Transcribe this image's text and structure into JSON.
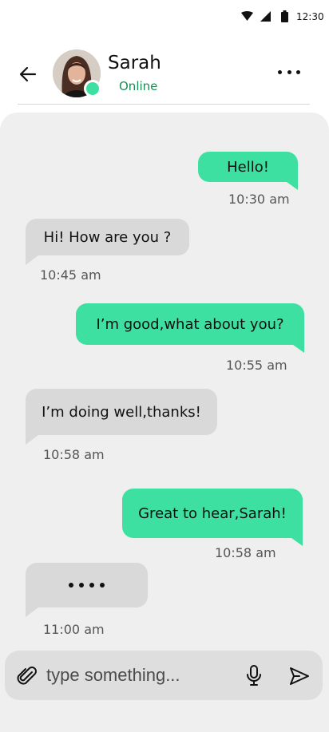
{
  "status_bar": {
    "time": "12:30"
  },
  "header": {
    "name": "Sarah",
    "presence": "Online"
  },
  "messages": [
    {
      "side": "sent",
      "text": "Hello!",
      "time": "10:30 am"
    },
    {
      "side": "recv",
      "text": "Hi! How are you ?",
      "time": "10:45 am"
    },
    {
      "side": "sent",
      "text": "I’m good,what about you?",
      "time": "10:55 am"
    },
    {
      "side": "recv",
      "text": "I’m doing well,thanks!",
      "time": "10:58 am"
    },
    {
      "side": "sent",
      "text": "Great to hear,Sarah!",
      "time": "10:58 am"
    },
    {
      "side": "recv",
      "text": "",
      "time": "11:00 am",
      "typing": true
    }
  ],
  "composer": {
    "placeholder": "type something..."
  },
  "colors": {
    "accent": "#3ee0a1",
    "received_bubble": "#d9d9d9",
    "chat_bg": "#efefef",
    "presence_text": "#1f8a55"
  },
  "icons": [
    "wifi-icon",
    "signal-icon",
    "battery-icon",
    "back-arrow-icon",
    "more-icon",
    "attach-icon",
    "mic-icon",
    "send-icon"
  ]
}
